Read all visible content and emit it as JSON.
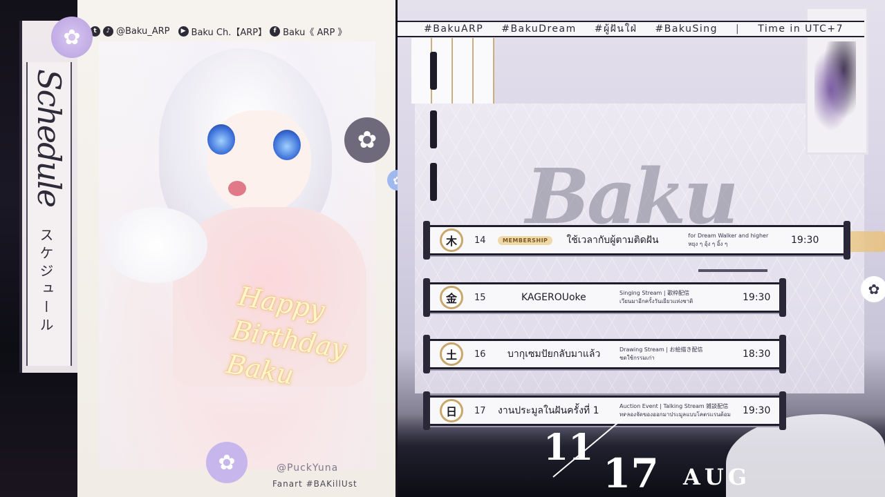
{
  "left_title": {
    "script": "Schedule",
    "kana": "スケジュール"
  },
  "socials": {
    "twitter_tiktok_handle": "@Baku_ARP",
    "youtube_channel": "Baku Ch.【ARP】",
    "facebook_page": "Baku《 ARP 》"
  },
  "art": {
    "greeting": "Happy Birthday Baku",
    "credit_name": "@PuckYuna",
    "credit_tag": "Fanart #BAKillUst"
  },
  "hashtag_bar": {
    "tags": [
      "#BakuARP",
      "#BakuDream",
      "#ผู้ฝันใฝ่",
      "#BakuSing"
    ],
    "separator": "|",
    "timezone": "Time in UTC+7"
  },
  "schedule": [
    {
      "kanji": "木",
      "date": "14",
      "badge": "MEMBERSHIP",
      "title": "ใช้เวลากับผู้ตามติดฝัน",
      "desc_line1": "for Dream Walker and higher",
      "desc_line2": "หยุง ๆ อุ้ง ๆ อิ้ง ๆ",
      "time": "19:30"
    },
    {
      "kanji": "金",
      "date": "15",
      "badge": "",
      "title": "KAGEROUoke",
      "desc_line1": "Singing Stream | 歌枠配信",
      "desc_line2": "เวียนมาอีกครั้งวันเยียวแห่งชาติ",
      "time": "19:30"
    },
    {
      "kanji": "土",
      "date": "16",
      "badge": "",
      "title": "บากุเซมปัยกลับมาแล้ว",
      "desc_line1": "Drawing Stream | お絵描き配信",
      "desc_line2": "ชดใช้กรรมเก่า",
      "time": "18:30"
    },
    {
      "kanji": "日",
      "date": "17",
      "badge": "",
      "title": "งานประมูลในฝันครั้งที่ 1",
      "desc_line1": "Auction Event | Talking Stream 雑談配信",
      "desc_line2": "ทดลองจัดของออกมาประมูลแบบโคตรแรนด้อม",
      "time": "19:30"
    }
  ],
  "date_range": {
    "start_day": "11",
    "end_day": "17",
    "month": "AUG"
  },
  "colors": {
    "frame": "#1f1d2b",
    "gold_accent": "#c9a66a",
    "lavender": "#b8a0e0",
    "panel": "#f8f7fa"
  },
  "icons": [
    "twitter-icon",
    "tiktok-icon",
    "youtube-icon",
    "facebook-icon",
    "plum-flower-icon"
  ]
}
